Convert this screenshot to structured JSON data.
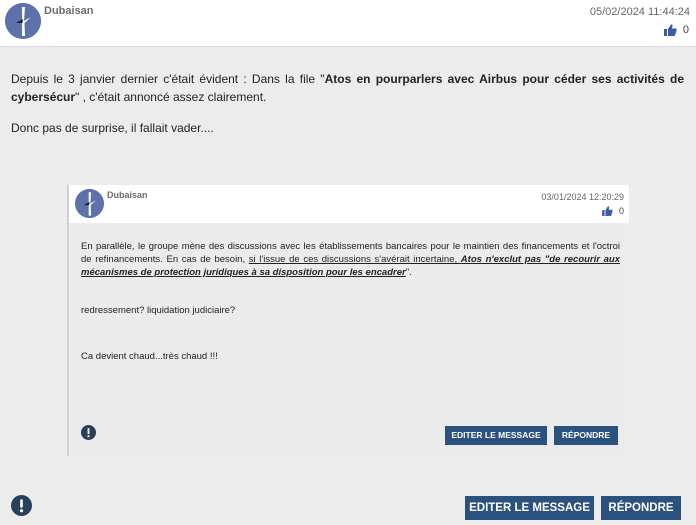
{
  "post": {
    "username": "Dubaisan",
    "timestamp": "05/02/2024 11:44:24",
    "likes": "0",
    "body": {
      "p1_a": "Depuis le 3 janvier dernier c'était évident : Dans la file \"",
      "p1_bold": "Atos en pourparlers avec Airbus pour céder ses activités de cybersécur",
      "p1_b": "\" , c'était annoncé assez clairement.",
      "p2": "Donc pas de surprise, il fallait vader...."
    },
    "edit_label": "EDITER LE MESSAGE",
    "reply_label": "RÉPONDRE"
  },
  "quote": {
    "username": "Dubaisan",
    "timestamp": "03/01/2024 12:20:29",
    "likes": "0",
    "body": {
      "p1_a": "En parallèle, le groupe mène des discussions avec les établissements bancaires pour le maintien des financements et l'octroi de refinancements. En cas de besoin, ",
      "p1_underline": "si l'issue de ces discussions s'avérait incertaine, ",
      "p1_emph": "Atos n'exclut pas \"de recourir aux mécanismes de protection juridiques à sa disposition pour les encadrer",
      "p1_b": "\".",
      "p2": "redressement? liquidation judiciaire?",
      "p3": "Ca devient chaud...très chaud !!!"
    },
    "edit_label": "EDITER LE MESSAGE",
    "reply_label": "RÉPONDRE"
  },
  "icons": {
    "avatar": "avatar-bird-icon",
    "like": "thumbs-up-icon",
    "alert": "exclamation-circle-icon"
  },
  "colors": {
    "button": "#2b527e",
    "like_icon": "#3b5ba5",
    "background": "#ececec"
  }
}
